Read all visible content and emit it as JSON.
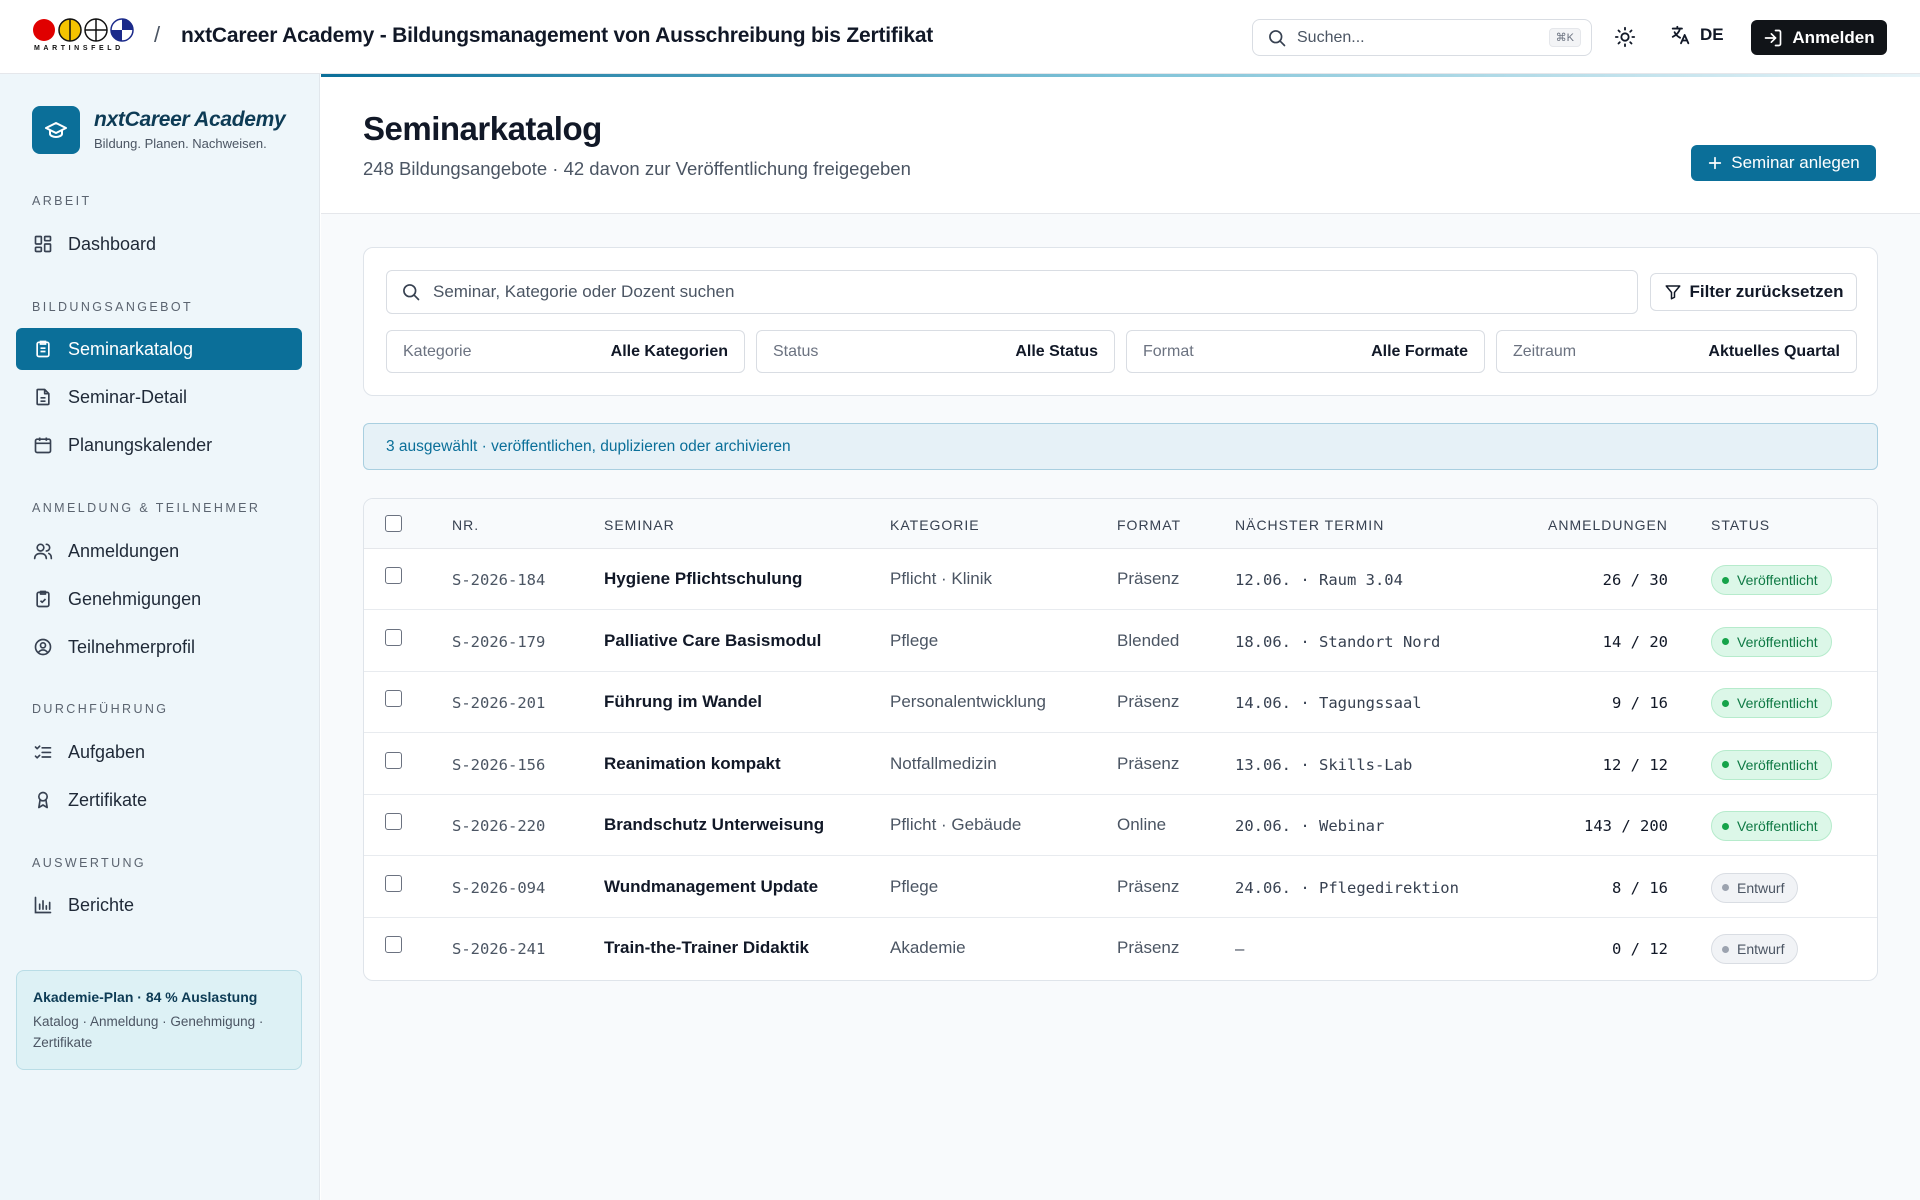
{
  "header": {
    "logo_word": "MARTINSFELD",
    "separator": "/",
    "app_title": "nxtCareer Academy - Bildungsmanagement von Ausschreibung bis Zertifikat",
    "search_placeholder": "Suchen...",
    "search_shortcut": "⌘K",
    "language": "DE",
    "login_label": "Anmelden"
  },
  "sidebar": {
    "brand_name": "nxtCareer Academy",
    "brand_tagline": "Bildung. Planen. Nachweisen.",
    "sections": [
      {
        "title": "ARBEIT",
        "items": [
          {
            "label": "Dashboard",
            "icon": "dashboard-icon"
          }
        ]
      },
      {
        "title": "BILDUNGSANGEBOT",
        "items": [
          {
            "label": "Seminarkatalog",
            "icon": "catalog-icon",
            "active": true
          },
          {
            "label": "Seminar-Detail",
            "icon": "document-icon"
          },
          {
            "label": "Planungskalender",
            "icon": "calendar-icon"
          }
        ]
      },
      {
        "title": "ANMELDUNG & TEILNEHMER",
        "items": [
          {
            "label": "Anmeldungen",
            "icon": "users-icon"
          },
          {
            "label": "Genehmigungen",
            "icon": "clipboard-check-icon"
          },
          {
            "label": "Teilnehmerprofil",
            "icon": "user-circle-icon"
          }
        ]
      },
      {
        "title": "DURCHFÜHRUNG",
        "items": [
          {
            "label": "Aufgaben",
            "icon": "checklist-icon"
          },
          {
            "label": "Zertifikate",
            "icon": "award-icon"
          }
        ]
      },
      {
        "title": "AUSWERTUNG",
        "items": [
          {
            "label": "Berichte",
            "icon": "bar-chart-icon"
          }
        ]
      }
    ],
    "plan_card": {
      "title": "Akademie-Plan · 84 % Auslastung",
      "text": "Katalog · Anmeldung · Genehmigung · Zertifikate"
    }
  },
  "page": {
    "title": "Seminarkatalog",
    "subtitle": "248 Bildungsangebote · 42 davon zur Veröffentlichung freigegeben",
    "add_button": "Seminar anlegen"
  },
  "filters": {
    "search_placeholder": "Seminar, Kategorie oder Dozent suchen",
    "reset_label": "Filter zurücksetzen",
    "selects": [
      {
        "label": "Kategorie",
        "value": "Alle Kategorien"
      },
      {
        "label": "Status",
        "value": "Alle Status"
      },
      {
        "label": "Format",
        "value": "Alle Formate"
      },
      {
        "label": "Zeitraum",
        "value": "Aktuelles Quartal"
      }
    ]
  },
  "bulk_bar": {
    "text": "3 ausgewählt · veröffentlichen, duplizieren oder archivieren"
  },
  "table": {
    "columns": [
      "NR.",
      "SEMINAR",
      "KATEGORIE",
      "FORMAT",
      "NÄCHSTER TERMIN",
      "ANMELDUNGEN",
      "STATUS"
    ],
    "rows": [
      {
        "nr": "S-2026-184",
        "seminar": "Hygiene Pflichtschulung",
        "kategorie": "Pflicht · Klinik",
        "format": "Präsenz",
        "termin": "12.06. · Raum 3.04",
        "anmeldungen": "26 / 30",
        "status": "Veröffentlicht",
        "status_type": "pub"
      },
      {
        "nr": "S-2026-179",
        "seminar": "Palliative Care Basismodul",
        "kategorie": "Pflege",
        "format": "Blended",
        "termin": "18.06. · Standort Nord",
        "anmeldungen": "14 / 20",
        "status": "Veröffentlicht",
        "status_type": "pub"
      },
      {
        "nr": "S-2026-201",
        "seminar": "Führung im Wandel",
        "kategorie": "Personalentwicklung",
        "format": "Präsenz",
        "termin": "14.06. · Tagungssaal",
        "anmeldungen": "9 / 16",
        "status": "Veröffentlicht",
        "status_type": "pub"
      },
      {
        "nr": "S-2026-156",
        "seminar": "Reanimation kompakt",
        "kategorie": "Notfallmedizin",
        "format": "Präsenz",
        "termin": "13.06. · Skills-Lab",
        "anmeldungen": "12 / 12",
        "status": "Veröffentlicht",
        "status_type": "pub"
      },
      {
        "nr": "S-2026-220",
        "seminar": "Brandschutz Unterweisung",
        "kategorie": "Pflicht · Gebäude",
        "format": "Online",
        "termin": "20.06. · Webinar",
        "anmeldungen": "143 / 200",
        "status": "Veröffentlicht",
        "status_type": "pub"
      },
      {
        "nr": "S-2026-094",
        "seminar": "Wundmanagement Update",
        "kategorie": "Pflege",
        "format": "Präsenz",
        "termin": "24.06. · Pflegedirektion",
        "anmeldungen": "8 / 16",
        "status": "Entwurf",
        "status_type": "draft"
      },
      {
        "nr": "S-2026-241",
        "seminar": "Train-the-Trainer Didaktik",
        "kategorie": "Akademie",
        "format": "Präsenz",
        "termin": "–",
        "anmeldungen": "0 / 12",
        "status": "Entwurf",
        "status_type": "draft"
      }
    ]
  },
  "colors": {
    "accent": "#0b6f99",
    "published": "#16a34a",
    "draft": "#9ca3af"
  }
}
